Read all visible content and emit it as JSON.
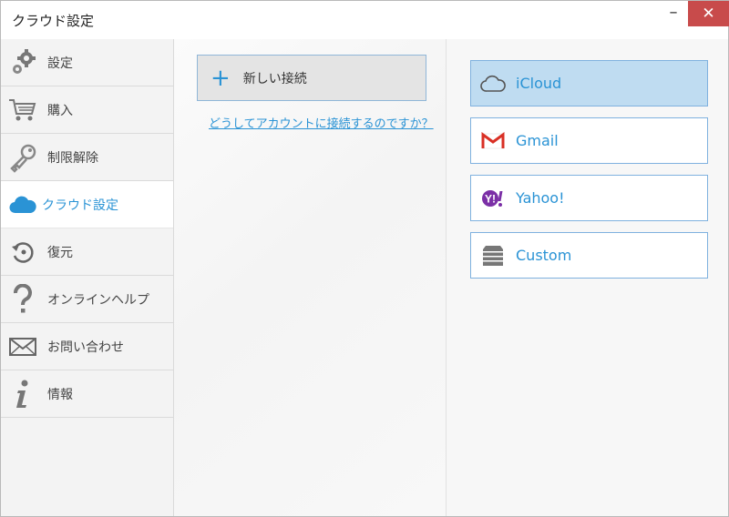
{
  "window": {
    "title": "クラウド設定",
    "minimize": "–",
    "close": "✕"
  },
  "sidebar": {
    "items": [
      {
        "label": "設定",
        "icon": "gears-icon"
      },
      {
        "label": "購入",
        "icon": "cart-icon"
      },
      {
        "label": "制限解除",
        "icon": "key-icon"
      },
      {
        "label": "クラウド設定",
        "icon": "cloud-icon",
        "active": true
      },
      {
        "label": "復元",
        "icon": "restore-icon"
      },
      {
        "label": "オンラインヘルプ",
        "icon": "question-icon"
      },
      {
        "label": "お問い合わせ",
        "icon": "envelope-icon"
      },
      {
        "label": "情報",
        "icon": "info-icon"
      }
    ]
  },
  "center": {
    "new_connection_plus": "+",
    "new_connection_label": "新しい接続",
    "help_link": "どうしてアカウントに接続するのですか？"
  },
  "providers": [
    {
      "label": "iCloud",
      "icon": "icloud-icon",
      "selected": true
    },
    {
      "label": "Gmail",
      "icon": "gmail-icon"
    },
    {
      "label": "Yahoo!",
      "icon": "yahoo-icon",
      "icon_text": "Y!"
    },
    {
      "label": "Custom",
      "icon": "server-icon"
    }
  ],
  "colors": {
    "accent": "#2a93d5",
    "close_button": "#c84b4b",
    "selected_provider": "#bfdcf1"
  }
}
